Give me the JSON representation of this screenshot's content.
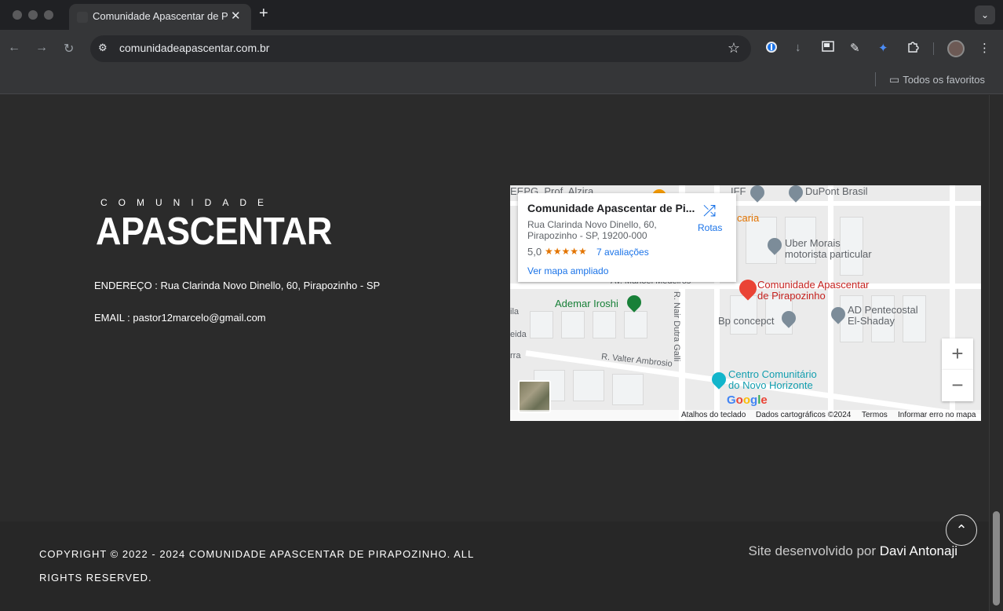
{
  "browser": {
    "tab_title": "Comunidade Apascentar de P",
    "url": "comunidadeapascentar.com.br",
    "bookmarks_folder": "Todos os favoritos",
    "icons": [
      "close-icon",
      "plus-icon",
      "chevron-down-icon",
      "back-icon",
      "forward-icon",
      "reload-icon",
      "site-settings-icon",
      "star-icon",
      "password-icon",
      "download-icon",
      "picture-in-picture-icon",
      "eyedropper-icon",
      "extension-icon",
      "puzzle-icon",
      "profile-avatar",
      "more-icon",
      "folder-icon"
    ]
  },
  "logo": {
    "top": "COMUNIDADE",
    "main": "APASCENTAR"
  },
  "contact": {
    "address": "ENDEREÇO : Rua Clarinda Novo Dinello, 60, Pirapozinho - SP",
    "email": "EMAIL : pastor12marcelo@gmail.com"
  },
  "map": {
    "card": {
      "title": "Comunidade Apascentar de Pi...",
      "address": "Rua Clarinda Novo Dinello, 60, Pirapozinho - SP, 19200-000",
      "rating": "5,0",
      "stars": "★★★★★",
      "reviews": "7 avaliações",
      "link": "Ver mapa ampliado",
      "directions": "Rotas"
    },
    "labels": {
      "eepg": "EEPG. Prof. Alzira",
      "iff": "IFF",
      "dupont": "DuPont Brasil",
      "caria": "caria",
      "uber1": "Uber Morais",
      "uber2": "motorista particular",
      "av_manoel": "Av. Manoel Medeiros",
      "place1": "Comunidade Apascentar",
      "place2": "de Pirapozinho",
      "ademar": "Ademar Iroshi",
      "rua_nair": "R. Nair Dutra Galli",
      "ad1": "AD Pentecostal",
      "ad2": "El-Shaday",
      "bp": "Bp concepct",
      "valter": "R. Valter Ambrosio",
      "centro1": "Centro Comunitário",
      "centro2": "do Novo Horizonte",
      "ila": "ila",
      "eida": "eida",
      "rra": "rra"
    },
    "zoom_in": "+",
    "zoom_out": "−",
    "attribution": {
      "keyboard": "Atalhos do teclado",
      "data": "Dados cartográficos ©2024",
      "terms": "Termos",
      "report": "Informar erro no mapa"
    },
    "google": "Google"
  },
  "footer": {
    "copyright": "COPYRIGHT © 2022 - 2024 COMUNIDADE APASCENTAR DE PIRAPOZINHO. ALL RIGHTS RESERVED.",
    "credit_prefix": "Site desenvolvido por",
    "credit_name": "Davi Antonaji",
    "back_to_top": "⌃"
  }
}
